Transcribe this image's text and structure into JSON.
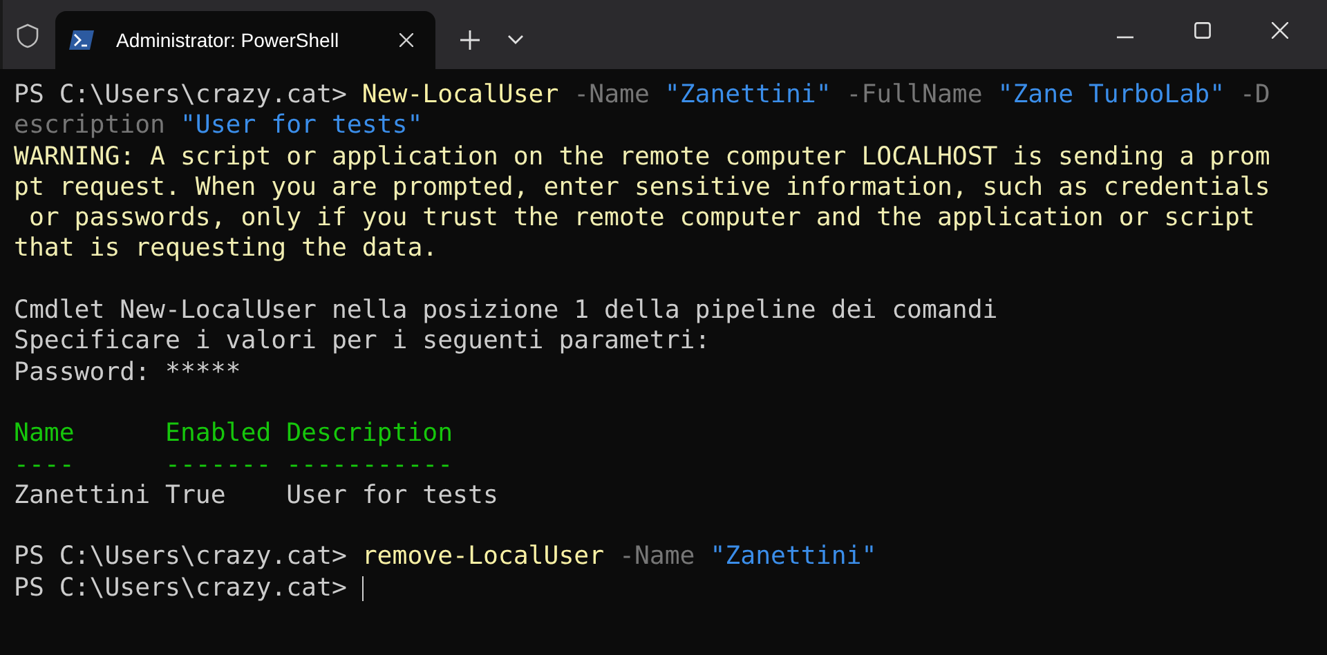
{
  "window": {
    "tabs": [
      {
        "title": "Administrator: PowerShell",
        "selected": true
      }
    ]
  },
  "terminal": {
    "lines": [
      {
        "kind": "text",
        "segments": [
          {
            "kind": "prompt",
            "text": "PS C:\\Users\\crazy.cat> "
          },
          {
            "kind": "command",
            "text": "New-LocalUser"
          },
          {
            "kind": "param",
            "text": " -Name "
          },
          {
            "kind": "string",
            "text": "\"Zanettini\""
          },
          {
            "kind": "param",
            "text": " -FullName "
          },
          {
            "kind": "string",
            "text": "\"Zane TurboLab\""
          },
          {
            "kind": "param",
            "text": " -D"
          }
        ]
      },
      {
        "kind": "text",
        "segments": [
          {
            "kind": "param",
            "text": "escription "
          },
          {
            "kind": "string",
            "text": "\"User for tests\""
          }
        ]
      },
      {
        "kind": "text",
        "segments": [
          {
            "kind": "warning",
            "text": "WARNING: A script or application on the remote computer LOCALHOST is sending a prom"
          }
        ]
      },
      {
        "kind": "text",
        "segments": [
          {
            "kind": "warning",
            "text": "pt request. When you are prompted, enter sensitive information, such as credentials"
          }
        ]
      },
      {
        "kind": "text",
        "segments": [
          {
            "kind": "warning",
            "text": " or passwords, only if you trust the remote computer and the application or script"
          }
        ]
      },
      {
        "kind": "text",
        "segments": [
          {
            "kind": "warning",
            "text": "that is requesting the data."
          }
        ]
      },
      {
        "kind": "blank"
      },
      {
        "kind": "text",
        "segments": [
          {
            "kind": "output",
            "text": "Cmdlet New-LocalUser nella posizione 1 della pipeline dei comandi"
          }
        ]
      },
      {
        "kind": "text",
        "segments": [
          {
            "kind": "output",
            "text": "Specificare i valori per i seguenti parametri:"
          }
        ]
      },
      {
        "kind": "text",
        "segments": [
          {
            "kind": "output",
            "text": "Password: *****"
          }
        ]
      },
      {
        "kind": "blank"
      },
      {
        "kind": "text",
        "segments": [
          {
            "kind": "header",
            "text": "Name      Enabled Description"
          }
        ]
      },
      {
        "kind": "text",
        "segments": [
          {
            "kind": "header",
            "text": "----      ------- -----------"
          }
        ]
      },
      {
        "kind": "text",
        "segments": [
          {
            "kind": "output",
            "text": "Zanettini True    User for tests"
          }
        ]
      },
      {
        "kind": "blank"
      },
      {
        "kind": "text",
        "segments": [
          {
            "kind": "prompt",
            "text": "PS C:\\Users\\crazy.cat> "
          },
          {
            "kind": "command",
            "text": "remove-LocalUser"
          },
          {
            "kind": "param",
            "text": " -Name "
          },
          {
            "kind": "string",
            "text": "\"Zanettini\""
          }
        ]
      },
      {
        "kind": "text",
        "segments": [
          {
            "kind": "prompt",
            "text": "PS C:\\Users\\crazy.cat> "
          },
          {
            "kind": "cursor"
          }
        ]
      }
    ]
  }
}
